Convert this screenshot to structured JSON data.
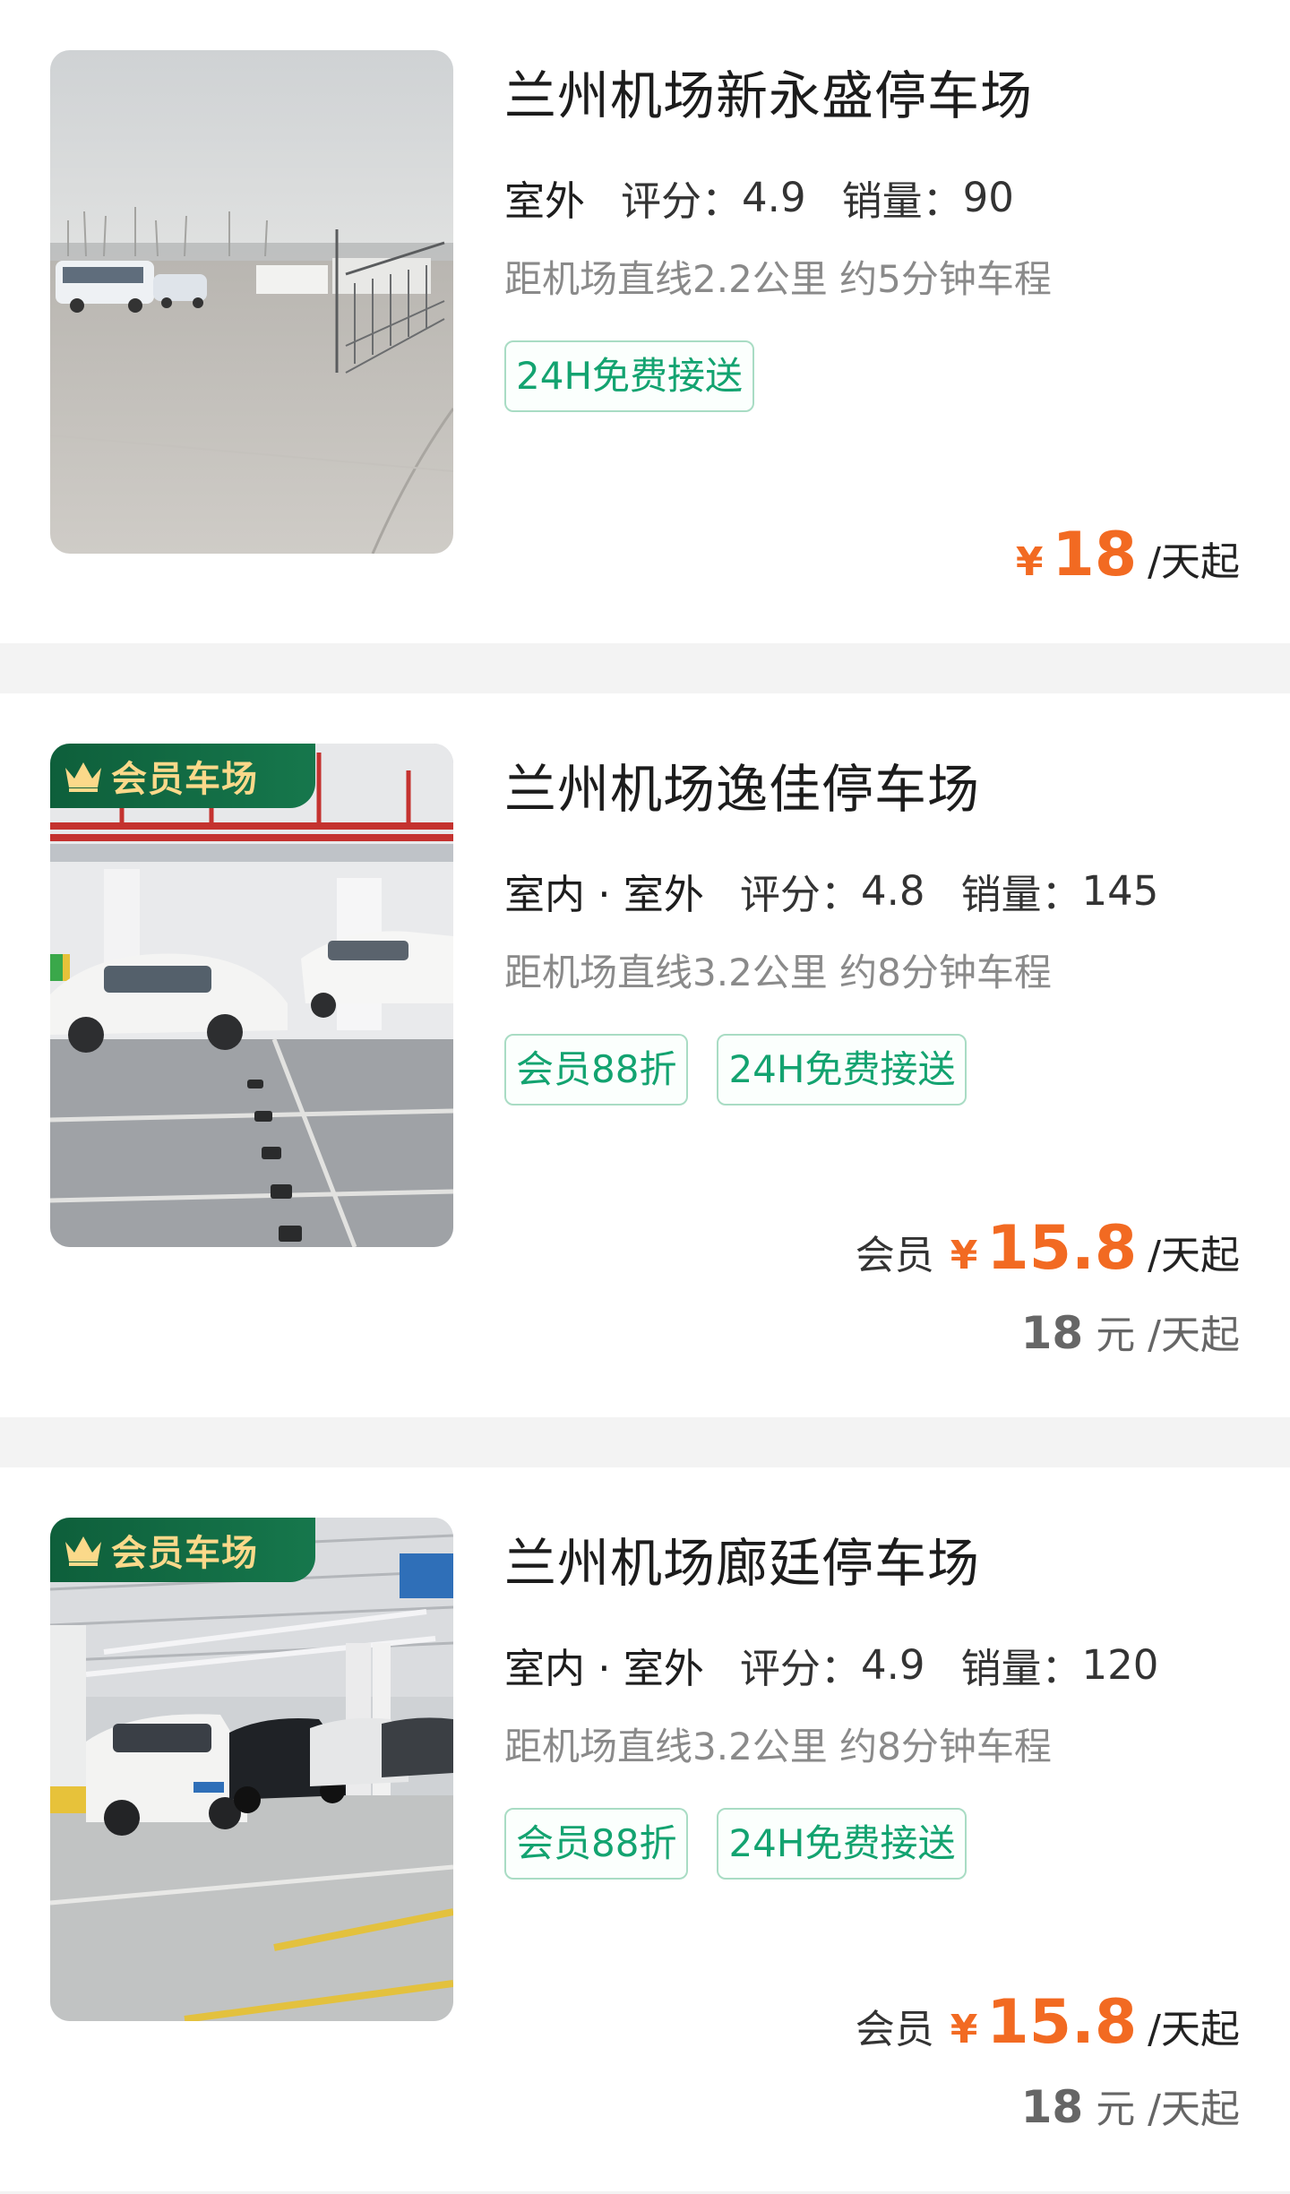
{
  "lots": [
    {
      "title": "兰州机场新永盛停车场",
      "type": "室外",
      "score_label": "评分：",
      "score": "4.9",
      "sales_label": "销量：",
      "sales": "90",
      "distance": "距机场直线2.2公里 约5分钟车程",
      "tags": [
        "24H免费接送"
      ],
      "price_symbol": "¥",
      "price": "18",
      "price_unit": "/天起",
      "member": false,
      "photo": "outdoor-parking-lot"
    },
    {
      "badge": "会员车场",
      "title": "兰州机场逸佳停车场",
      "type": "室内 · 室外",
      "score_label": "评分：",
      "score": "4.8",
      "sales_label": "销量：",
      "sales": "145",
      "distance": "距机场直线3.2公里 约8分钟车程",
      "tags": [
        "会员88折",
        "24H免费接送"
      ],
      "member_label": "会员",
      "price_symbol": "¥",
      "price": "15.8",
      "price_unit": "/天起",
      "orig_price": "18",
      "orig_unit": "元 /天起",
      "member": true,
      "photo": "indoor-garage"
    },
    {
      "badge": "会员车场",
      "title": "兰州机场廊廷停车场",
      "type": "室内 · 室外",
      "score_label": "评分：",
      "score": "4.9",
      "sales_label": "销量：",
      "sales": "120",
      "distance": "距机场直线3.2公里 约8分钟车程",
      "tags": [
        "会员88折",
        "24H免费接送"
      ],
      "member_label": "会员",
      "price_symbol": "¥",
      "price": "15.8",
      "price_unit": "/天起",
      "orig_price": "18",
      "orig_unit": "元 /天起",
      "member": true,
      "photo": "indoor-garage"
    }
  ],
  "colors": {
    "price": "#f26a22",
    "tag_text": "#13a370",
    "tag_border": "#a9dcc4",
    "badge_bg": "#0e5f3b",
    "badge_text": "#fbd98a",
    "separator": "#f3f3f3"
  }
}
